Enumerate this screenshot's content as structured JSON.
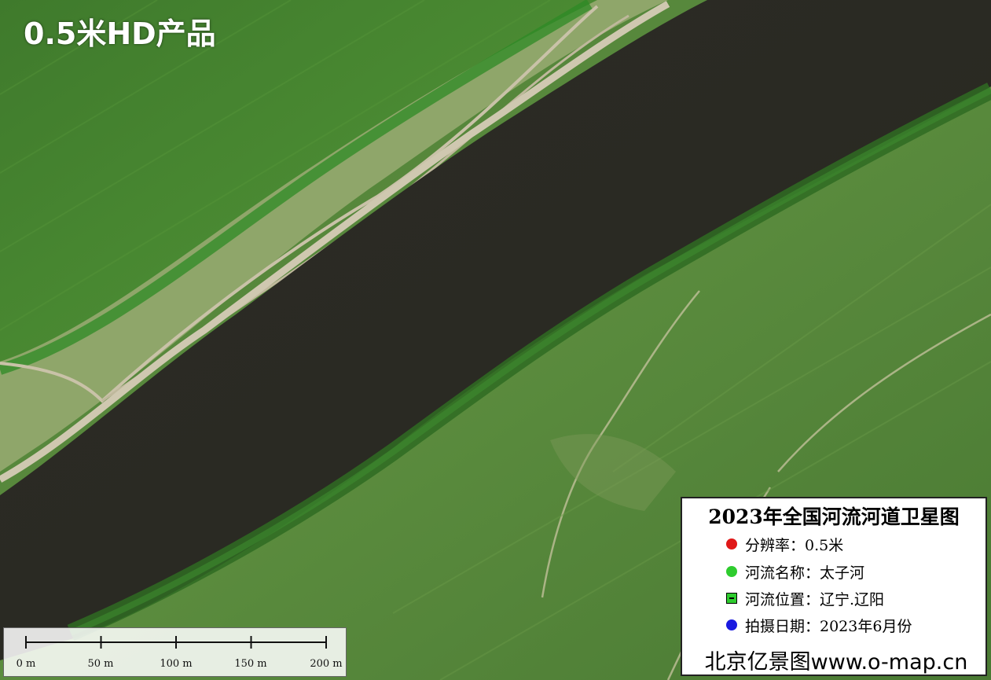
{
  "badge": "0.5米HD产品",
  "legend": {
    "title": "2023年全国河流河道卫星图",
    "items": [
      {
        "marker": "red-dot",
        "color": "#e01818",
        "text": "分辨率：0.5米"
      },
      {
        "marker": "green-dot",
        "color": "#2ecc2e",
        "text": "河流名称：太子河"
      },
      {
        "marker": "green-flag-icon",
        "color": "#2ecc2e",
        "text": "河流位置：辽宁.辽阳"
      },
      {
        "marker": "blue-dot",
        "color": "#1a1ae0",
        "text": "拍摄日期：2023年6月份"
      }
    ],
    "credit": "北京亿景图www.o-map.cn"
  },
  "scale_bar": {
    "labels": [
      "0 m",
      "50 m",
      "100 m",
      "150 m",
      "200 m"
    ]
  }
}
